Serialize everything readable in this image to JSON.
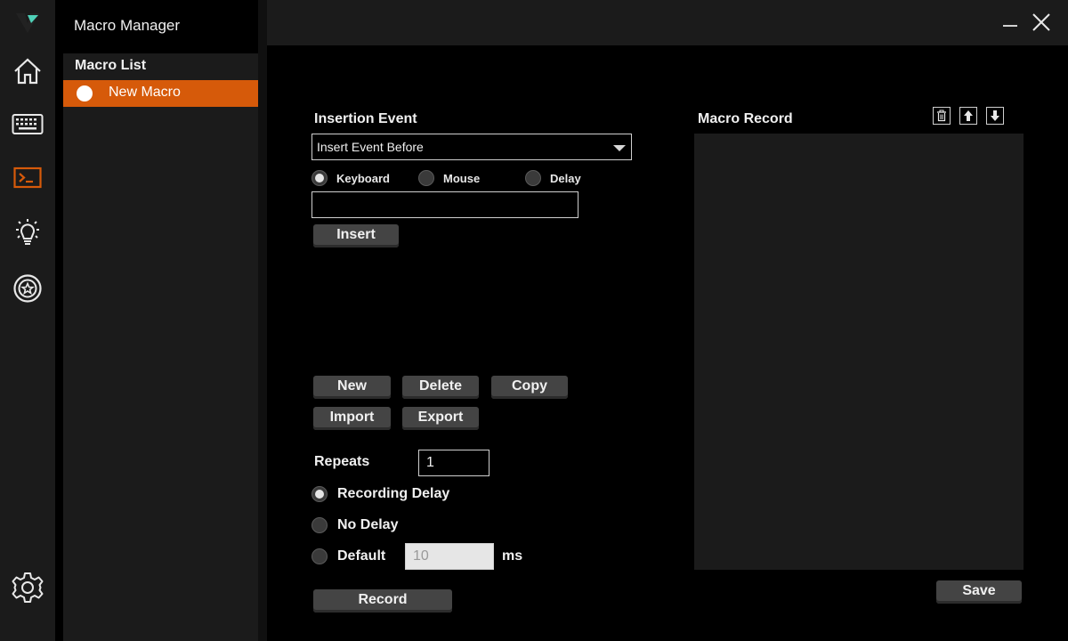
{
  "app": {
    "title": "Macro Manager",
    "accent": "#d65a0a"
  },
  "rail": {
    "icons": [
      "home-icon",
      "keyboard-icon",
      "macro-terminal-icon",
      "lighting-bulb-icon",
      "star-badge-icon",
      "settings-gear-icon"
    ],
    "active": "macro-terminal-icon"
  },
  "window": {
    "minimize_icon": "minimize-icon",
    "close_icon": "close-icon"
  },
  "macro_list": {
    "title": "Macro List",
    "items": [
      {
        "label": "New Macro",
        "selected": true
      }
    ]
  },
  "insertion": {
    "title": "Insertion Event",
    "select_value": "Insert Event Before",
    "types": [
      "Keyboard",
      "Mouse",
      "Delay"
    ],
    "selected_type": "Keyboard",
    "input_value": "",
    "insert_label": "Insert"
  },
  "actions": {
    "new": "New",
    "delete": "Delete",
    "copy": "Copy",
    "import": "Import",
    "export": "Export"
  },
  "repeats": {
    "label": "Repeats",
    "value": "1"
  },
  "delay": {
    "options": [
      "Recording Delay",
      "No Delay",
      "Default"
    ],
    "selected": "Recording Delay",
    "default_value": "10",
    "unit": "ms"
  },
  "record": {
    "label": "Record"
  },
  "macro_record": {
    "title": "Macro Record",
    "tools": [
      "trash-icon",
      "move-up-icon",
      "move-down-icon"
    ],
    "save_label": "Save"
  }
}
